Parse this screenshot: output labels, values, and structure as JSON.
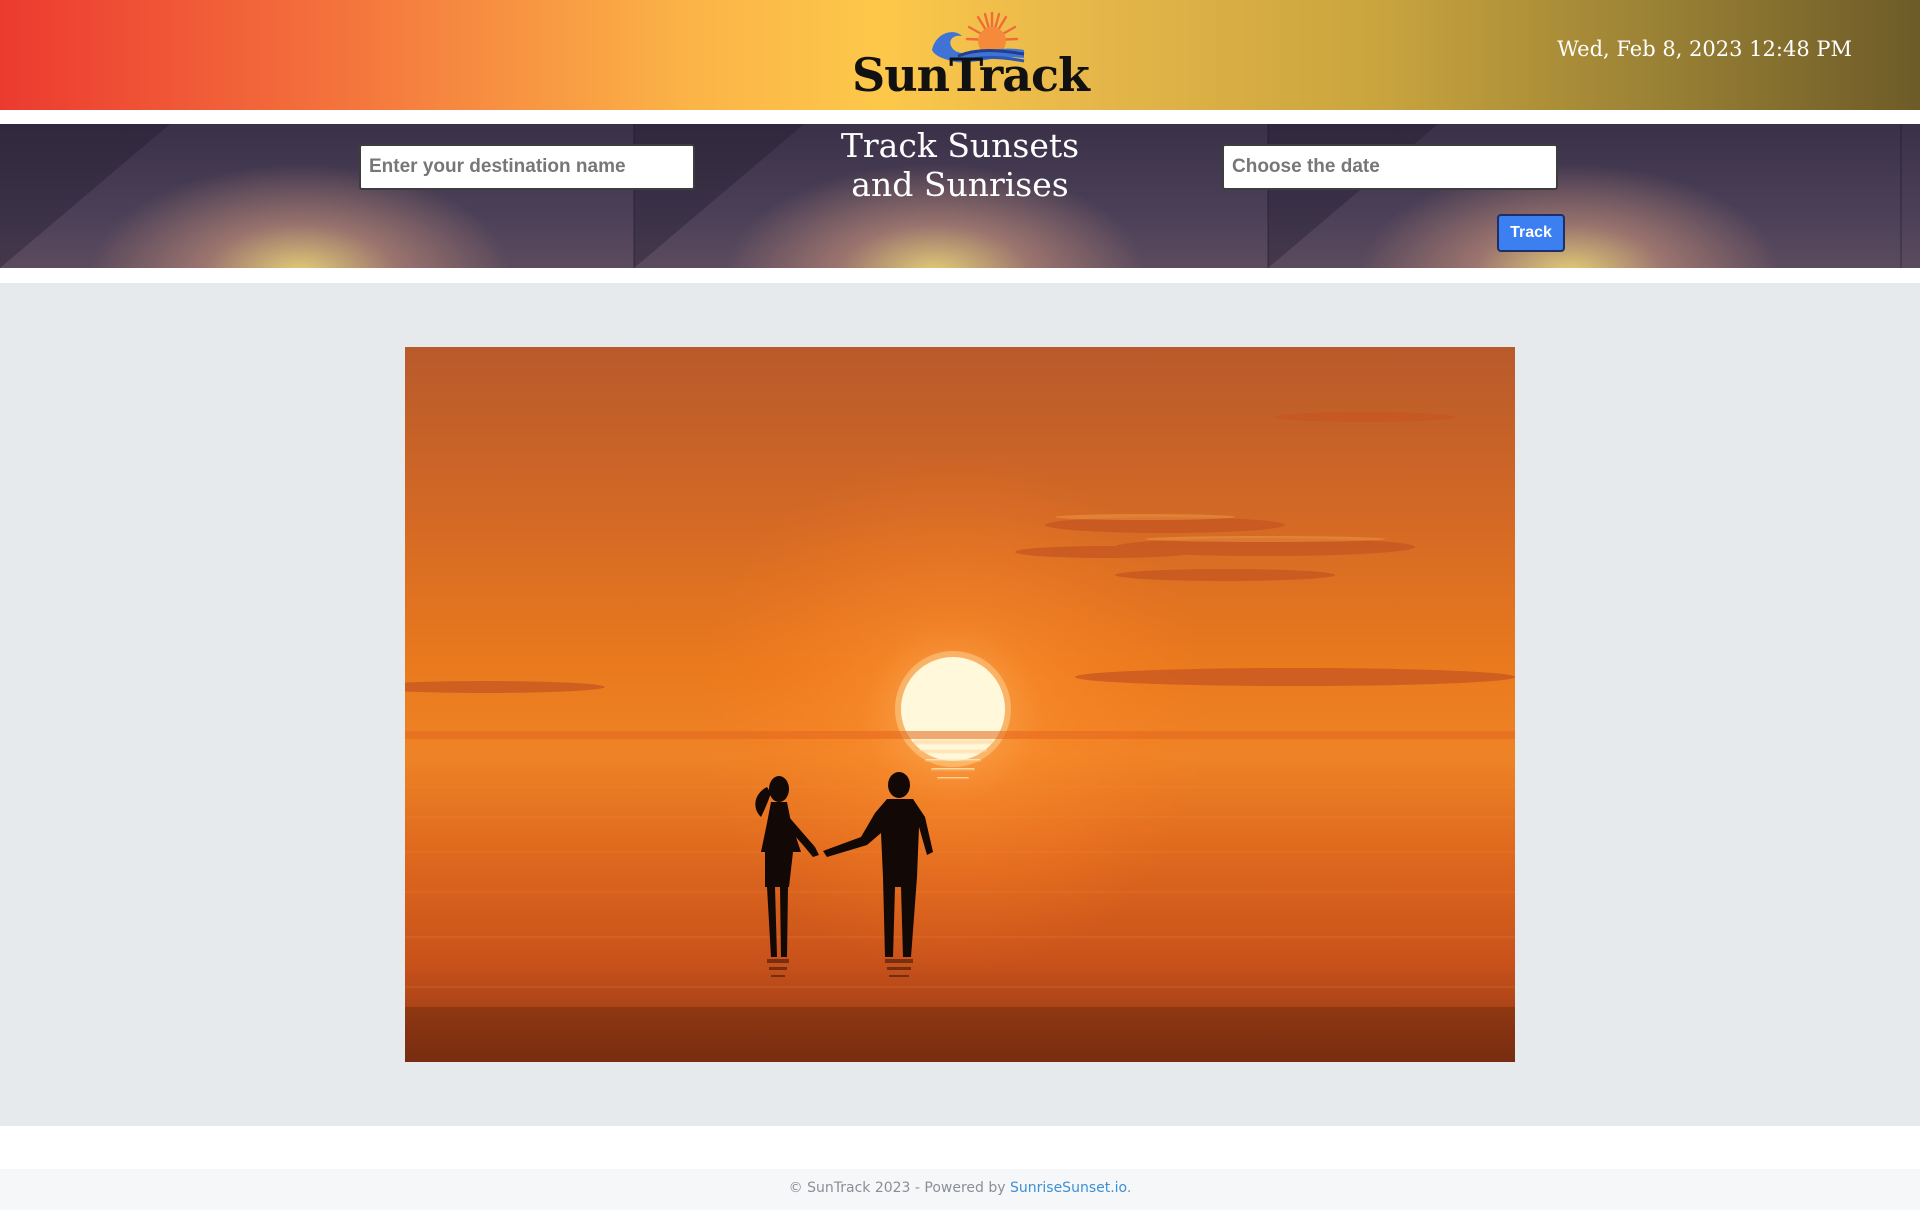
{
  "header": {
    "logo_text": "SunTrack",
    "datetime": "Wed, Feb 8, 2023 12:48 PM"
  },
  "search": {
    "title": "Track Sunsets and Sunrises",
    "destination_placeholder": "Enter your destination name",
    "date_placeholder": "Choose the date",
    "track_label": "Track"
  },
  "footer": {
    "prefix": "© SunTrack 2023 - Powered by ",
    "link_label": "SunriseSunset.io",
    "suffix": "."
  },
  "colors": {
    "accent": "#3b7ff0",
    "link": "#3d8fd6",
    "main_background": "#e7eaed"
  }
}
